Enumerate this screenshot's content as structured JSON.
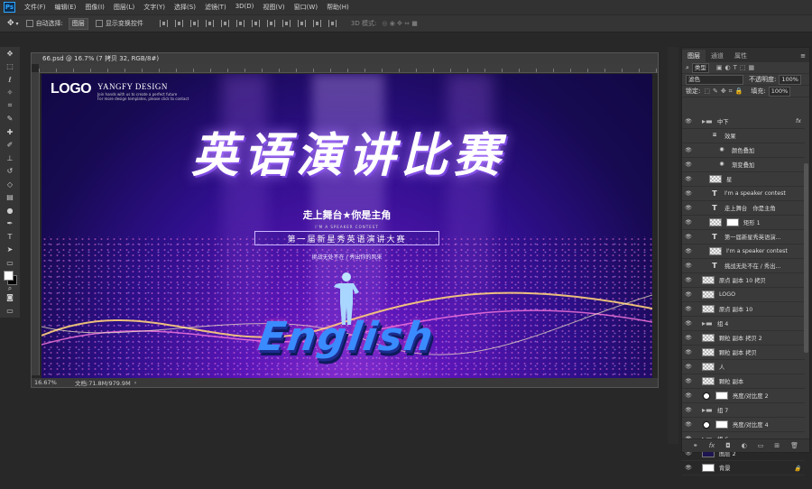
{
  "app": {
    "logo": "Ps"
  },
  "menu": [
    "文件(F)",
    "编辑(E)",
    "图像(I)",
    "图层(L)",
    "文字(Y)",
    "选择(S)",
    "滤镜(T)",
    "3D(D)",
    "视图(V)",
    "窗口(W)",
    "帮助(H)"
  ],
  "options": {
    "auto_select_label": "自动选择:",
    "auto_select_value": "图层",
    "show_transform_label": "显示变换控件",
    "mode_3d_label": "3D 模式:"
  },
  "tools": [
    "move-tool",
    "marquee-tool",
    "lasso-tool",
    "magic-wand-tool",
    "crop-tool",
    "eyedropper-tool",
    "healing-tool",
    "brush-tool",
    "stamp-tool",
    "history-brush-tool",
    "eraser-tool",
    "gradient-tool",
    "dodge-tool",
    "pen-tool",
    "type-tool",
    "path-select-tool",
    "rectangle-tool",
    "hand-tool",
    "zoom-tool"
  ],
  "document": {
    "tab_title": "66.psd @ 16.7% (7 拷贝 32, RGB/8#)",
    "zoom": "16.67%",
    "doc_size": "文档:71.8M/979.9M"
  },
  "poster": {
    "logo": "LOGO",
    "brand": "YANGFY DESIGN",
    "brand_sub1": "Join hands with us to create a perfect future",
    "brand_sub2": "For more design templates, please click to contact",
    "title": "英语演讲比赛",
    "slogan": "走上舞台★你是主角",
    "contest_en": "I'M A SPEAKER CONTEST",
    "subtitle": "第一届新星秀英语演讲大赛",
    "tagline": "挑战无处不在 / 秀出你的风采",
    "english_word": "English"
  },
  "layers_panel": {
    "tabs": [
      "图层",
      "通道",
      "属性"
    ],
    "filter_label": "类型",
    "blend_mode": "滤色",
    "opacity_label": "不透明度:",
    "opacity_value": "100%",
    "lock_label": "锁定:",
    "fill_label": "填充:",
    "fill_value": "100%",
    "layers": [
      {
        "name": "中下",
        "kind": "folder",
        "indent": 1,
        "fx": "fx"
      },
      {
        "name": "效果",
        "kind": "effect",
        "indent": 2
      },
      {
        "name": "颜色叠加",
        "kind": "effect",
        "indent": 3
      },
      {
        "name": "渐变叠加",
        "kind": "effect",
        "indent": 3
      },
      {
        "name": "星",
        "kind": "pixel",
        "indent": 2
      },
      {
        "name": "I'm a speaker contest",
        "kind": "text",
        "indent": 2
      },
      {
        "name": "走上舞台　你是主角",
        "kind": "text",
        "indent": 2
      },
      {
        "name": "矩形 1",
        "kind": "shape",
        "indent": 2
      },
      {
        "name": "第一届新星秀英语演...",
        "kind": "text",
        "indent": 2
      },
      {
        "name": "I'm a speaker contest",
        "kind": "pixel",
        "indent": 2
      },
      {
        "name": "挑战无处不在 / 秀出...",
        "kind": "text",
        "indent": 2
      },
      {
        "name": "原点 副本 10 拷贝",
        "kind": "pixel",
        "indent": 1
      },
      {
        "name": "LOGO",
        "kind": "pixel",
        "indent": 1
      },
      {
        "name": "原点 副本 10",
        "kind": "pixel",
        "indent": 1
      },
      {
        "name": "组 4",
        "kind": "folder",
        "indent": 1
      },
      {
        "name": "颗粒 副本 拷贝 2",
        "kind": "pixel",
        "indent": 1
      },
      {
        "name": "颗粒 副本 拷贝",
        "kind": "pixel",
        "indent": 1
      },
      {
        "name": "人",
        "kind": "pixel",
        "indent": 1
      },
      {
        "name": "颗粒 副本",
        "kind": "pixel",
        "indent": 1
      },
      {
        "name": "亮度/对比度 2",
        "kind": "adjust",
        "indent": 1
      },
      {
        "name": "组 7",
        "kind": "folder",
        "indent": 1
      },
      {
        "name": "亮度/对比度 4",
        "kind": "adjust",
        "indent": 1
      },
      {
        "name": "组 6",
        "kind": "folder",
        "indent": 1
      },
      {
        "name": "图层 2",
        "kind": "dark",
        "indent": 1
      },
      {
        "name": "背景",
        "kind": "white",
        "indent": 1
      }
    ],
    "footer_icons": [
      "link-icon",
      "fx-icon",
      "mask-icon",
      "adjustment-icon",
      "group-icon",
      "new-layer-icon",
      "trash-icon"
    ]
  },
  "colors": {
    "accent": "#31a8ff",
    "canvas_top": "#170a52",
    "canvas_glow": "#8a2fd0"
  }
}
